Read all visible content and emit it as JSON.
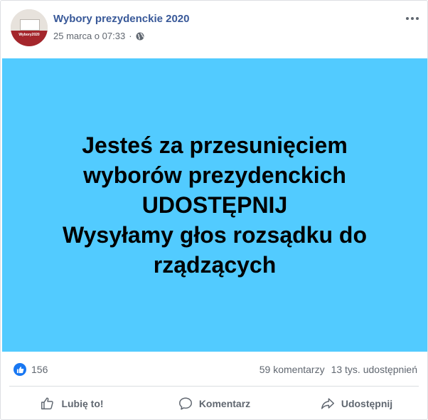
{
  "post": {
    "page_name": "Wybory prezydenckie 2020",
    "avatar_text": "Wybory2020",
    "timestamp": "25 marca o 07:33",
    "privacy_icon": "globe-icon",
    "menu_icon": "more-options-icon",
    "image_lines": [
      "Jesteś za przesunięciem",
      "wyborów prezydenckich",
      "UDOSTĘPNIJ",
      "Wysyłamy głos rozsądku do",
      "rządzących"
    ],
    "image_bg_color": "#52cbff"
  },
  "stats": {
    "likes": "156",
    "comments": "59 komentarzy",
    "shares": "13 tys. udostępnień"
  },
  "actions": {
    "like": "Lubię to!",
    "comment": "Komentarz",
    "share": "Udostępnij"
  },
  "colors": {
    "link_blue": "#385898",
    "like_blue": "#1877f2",
    "muted_text": "#606770"
  }
}
